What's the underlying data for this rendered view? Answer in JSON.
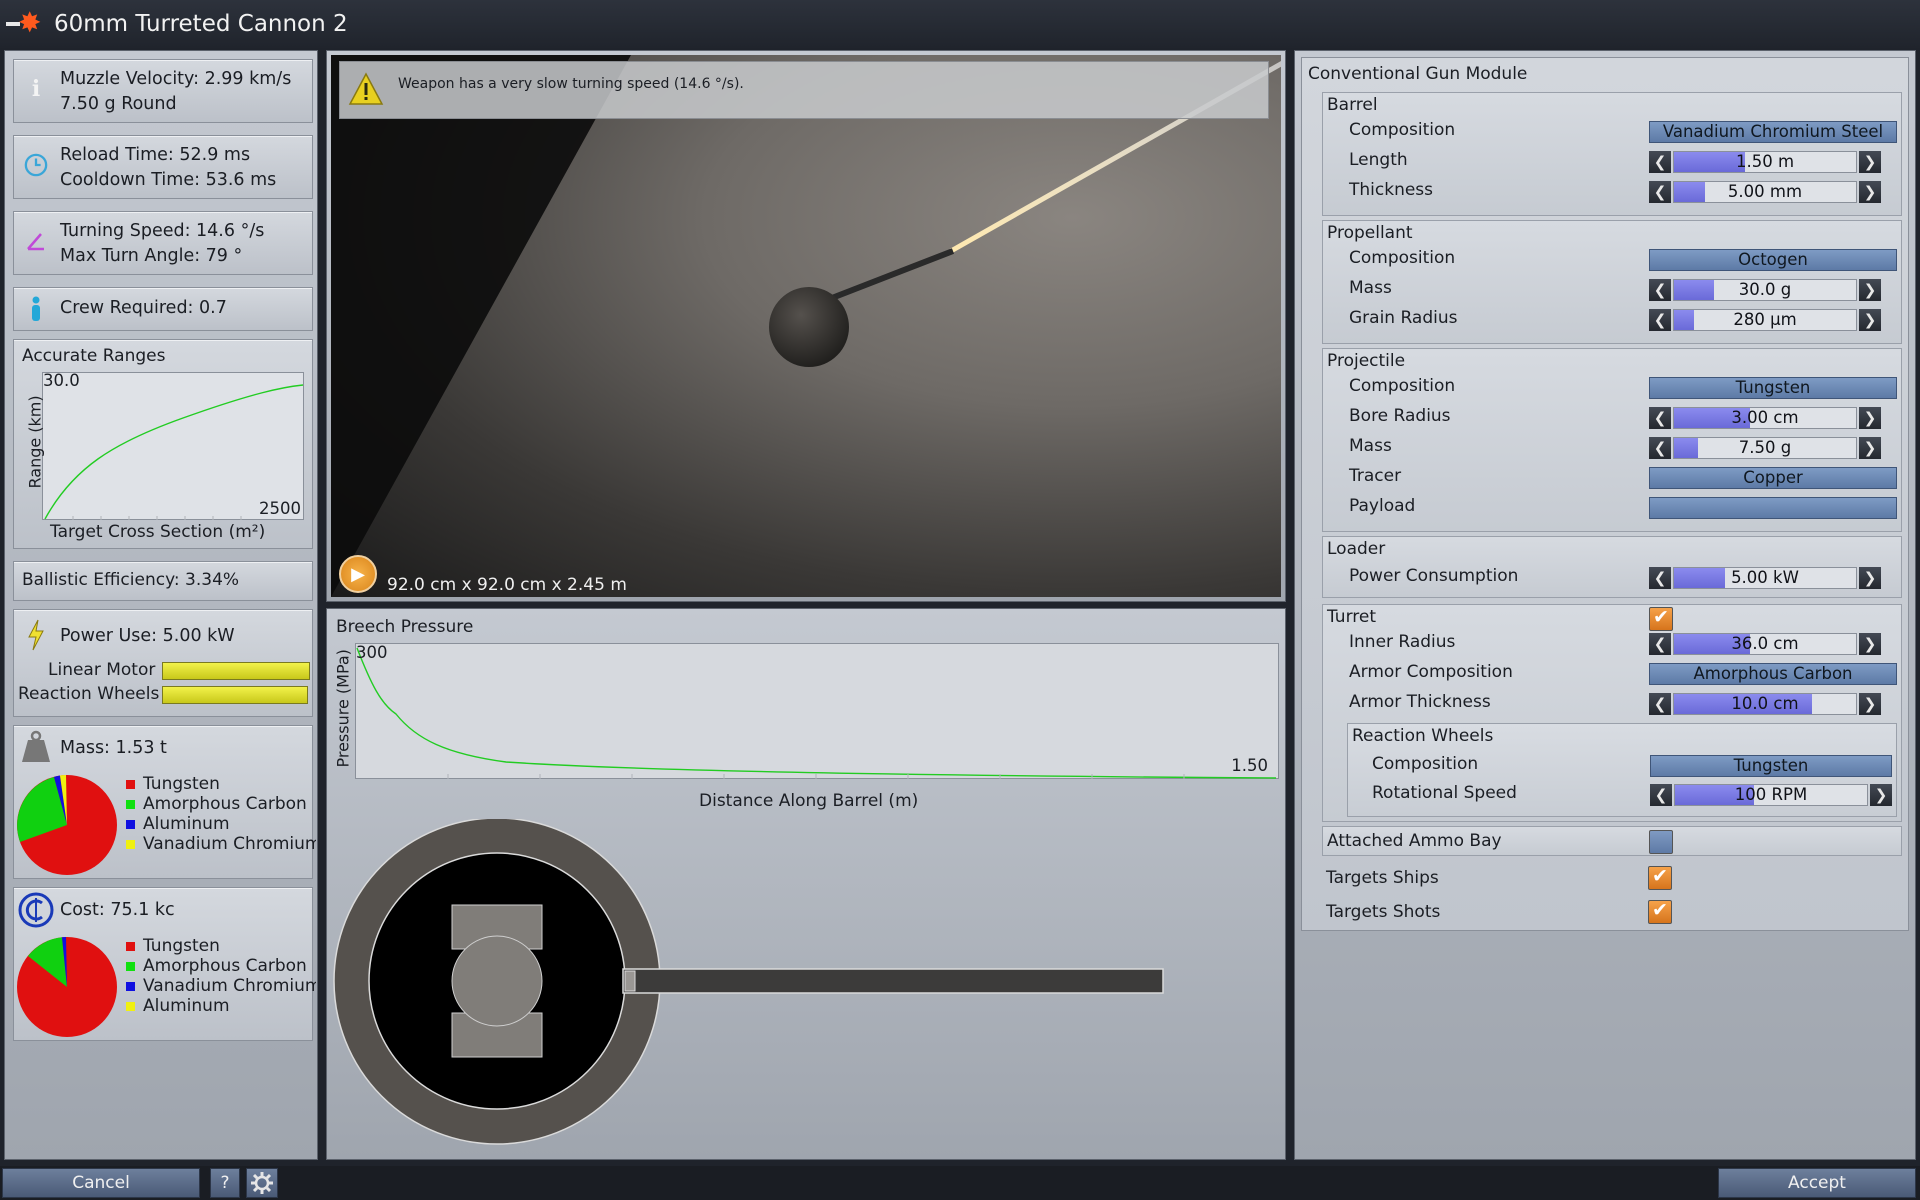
{
  "window": {
    "title": "60mm Turreted Cannon 2"
  },
  "stats": {
    "muzzle_velocity": "Muzzle Velocity: 2.99 km/s",
    "round": "7.50 g Round",
    "reload_time": "Reload Time: 52.9 ms",
    "cooldown_time": "Cooldown Time: 53.6 ms",
    "turning_speed": "Turning Speed: 14.6 °/s",
    "max_turn_angle": "Max Turn Angle: 79 °",
    "crew_required": "Crew Required: 0.7",
    "ballistic_efficiency": "Ballistic Efficiency: 3.34%",
    "power_use": "Power Use: 5.00 kW",
    "linear_motor_label": "Linear Motor",
    "reaction_wheels_label": "Reaction Wheels",
    "mass": "Mass: 1.53 t",
    "cost": "Cost: 75.1 kc"
  },
  "mass_legend": [
    {
      "label": "Tungsten",
      "color": "#e01010"
    },
    {
      "label": "Amorphous Carbon",
      "color": "#10e010"
    },
    {
      "label": "Aluminum",
      "color": "#1010e0"
    },
    {
      "label": "Vanadium Chromium",
      "color": "#f0f010"
    }
  ],
  "cost_legend": [
    {
      "label": "Tungsten",
      "color": "#e01010"
    },
    {
      "label": "Amorphous Carbon",
      "color": "#10e010"
    },
    {
      "label": "Vanadium Chromium",
      "color": "#1010e0"
    },
    {
      "label": "Aluminum",
      "color": "#f0f010"
    }
  ],
  "accurate_ranges": {
    "title": "Accurate Ranges",
    "ylabel": "Range (km)",
    "xlabel": "Target Cross Section (m²)",
    "ymax_label": "30.0",
    "xmax_label": "2500"
  },
  "viewport": {
    "warning": "Weapon has a very slow turning speed (14.6 °/s).",
    "dimensions": "92.0 cm x 92.0 cm x 2.45 m"
  },
  "breech_pressure": {
    "title": "Breech Pressure",
    "ylabel": "Pressure (MPa)",
    "xlabel": "Distance Along Barrel (m)",
    "ymax_label": "300",
    "xmax_label": "1.50"
  },
  "module": {
    "title": "Conventional Gun Module",
    "barrel": {
      "title": "Barrel",
      "composition_label": "Composition",
      "composition": "Vanadium Chromium Steel",
      "length_label": "Length",
      "length": "1.50 m",
      "thickness_label": "Thickness",
      "thickness": "5.00 mm"
    },
    "propellant": {
      "title": "Propellant",
      "composition_label": "Composition",
      "composition": "Octogen",
      "mass_label": "Mass",
      "mass": "30.0 g",
      "grain_radius_label": "Grain Radius",
      "grain_radius": "280 µm"
    },
    "projectile": {
      "title": "Projectile",
      "composition_label": "Composition",
      "composition": "Tungsten",
      "bore_radius_label": "Bore Radius",
      "bore_radius": "3.00 cm",
      "mass_label": "Mass",
      "mass": "7.50 g",
      "tracer_label": "Tracer",
      "tracer": "Copper",
      "payload_label": "Payload",
      "payload": ""
    },
    "loader": {
      "title": "Loader",
      "power_label": "Power Consumption",
      "power": "5.00 kW"
    },
    "turret": {
      "title": "Turret",
      "inner_radius_label": "Inner Radius",
      "inner_radius": "36.0 cm",
      "armor_composition_label": "Armor Composition",
      "armor_composition": "Amorphous Carbon",
      "armor_thickness_label": "Armor Thickness",
      "armor_thickness": "10.0 cm",
      "reaction_wheels_title": "Reaction Wheels",
      "rw_composition_label": "Composition",
      "rw_composition": "Tungsten",
      "rw_speed_label": "Rotational Speed",
      "rw_speed": "100 RPM"
    },
    "attached_ammo_bay_label": "Attached Ammo Bay",
    "targets_ships_label": "Targets Ships",
    "targets_shots_label": "Targets Shots"
  },
  "slider_levels": {
    "barrel_length": 0.39,
    "barrel_thickness": 0.17,
    "propellant_mass": 0.22,
    "grain_radius": 0.11,
    "bore_radius": 0.42,
    "projectile_mass": 0.13,
    "loader_power": 0.28,
    "inner_radius": 0.42,
    "armor_thickness": 0.76,
    "rw_speed": 0.41
  },
  "bottom": {
    "cancel": "Cancel",
    "help": "?",
    "accept": "Accept"
  }
}
